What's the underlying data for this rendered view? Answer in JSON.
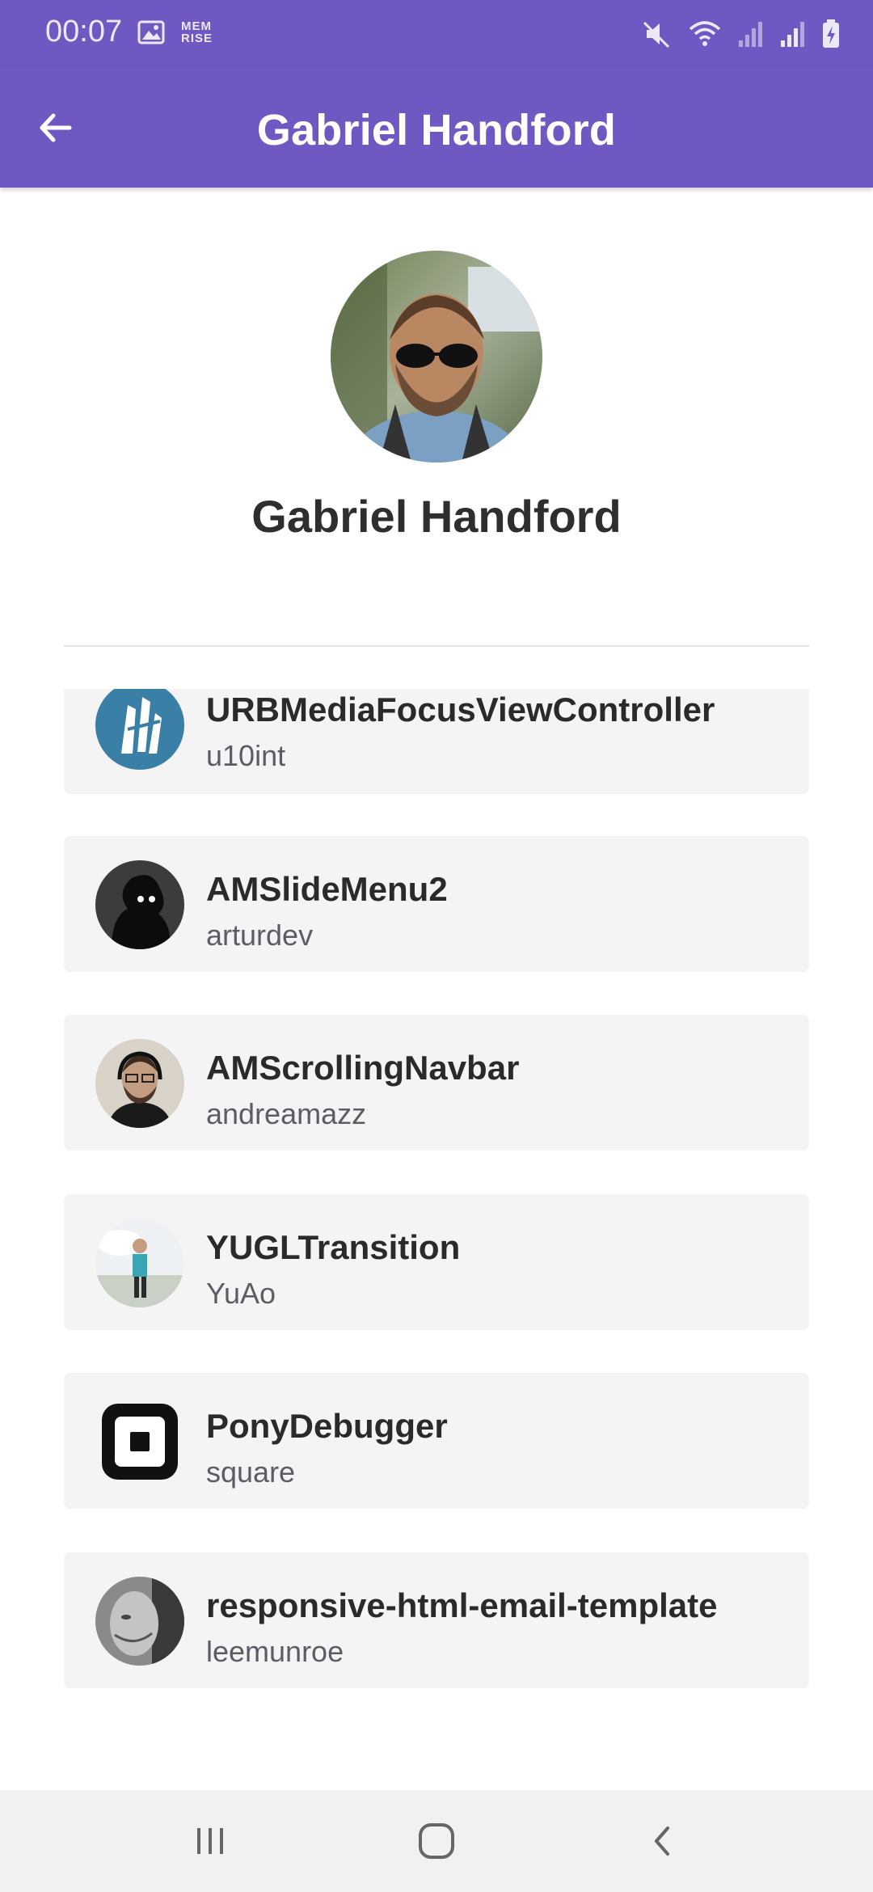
{
  "status_bar": {
    "time": "00:07",
    "left_icons": [
      "gallery-icon",
      "memrise-icon"
    ],
    "memrise_text": "MEM RISE",
    "right_icons": [
      "mute-icon",
      "wifi-icon",
      "signal-icon",
      "signal-icon",
      "battery-charging-icon"
    ]
  },
  "app_bar": {
    "title": "Gabriel Handford",
    "back_icon": "arrow-left-icon",
    "background": "#7058c2"
  },
  "profile": {
    "name": "Gabriel Handford"
  },
  "repos": [
    {
      "name": "URBMediaFocusViewController",
      "owner": "u10int"
    },
    {
      "name": "AMSlideMenu2",
      "owner": "arturdev"
    },
    {
      "name": "AMScrollingNavbar",
      "owner": "andreamazz"
    },
    {
      "name": "YUGLTransition",
      "owner": "YuAo"
    },
    {
      "name": "PonyDebugger",
      "owner": "square"
    },
    {
      "name": "responsive-html-email-template",
      "owner": "leemunroe"
    }
  ],
  "nav_bar": {
    "buttons": [
      "recents-icon",
      "home-icon",
      "back-icon"
    ]
  }
}
